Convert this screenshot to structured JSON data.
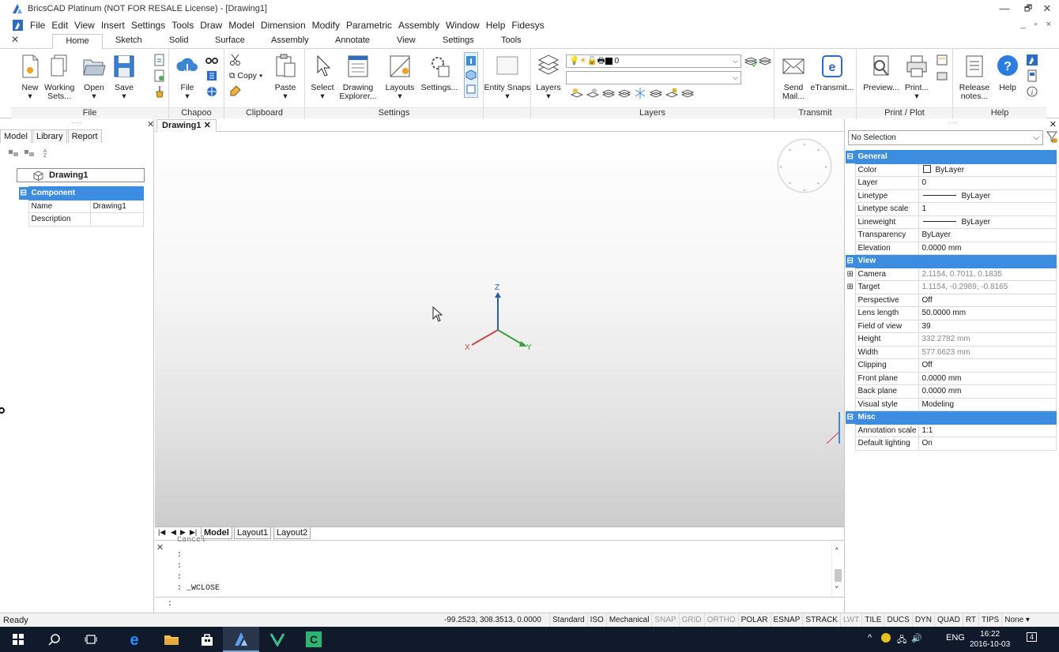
{
  "titlebar": {
    "title": "BricsCAD Platinum (NOT FOR RESALE License) - [Drawing1]",
    "minimize": "—",
    "restore": "🗗",
    "close": "✕"
  },
  "menubar": {
    "items": [
      "File",
      "Edit",
      "View",
      "Insert",
      "Settings",
      "Tools",
      "Draw",
      "Model",
      "Dimension",
      "Modify",
      "Parametric",
      "Assembly",
      "Window",
      "Help",
      "Fidesys"
    ],
    "mdi_controls": "_ ▫ ×"
  },
  "ribbon_tabs": [
    "Home",
    "Sketch",
    "Solid",
    "Surface",
    "Assembly",
    "Annotate",
    "View",
    "Settings",
    "Tools"
  ],
  "ribbon": {
    "groups": {
      "file": "File",
      "chapoo": "Chapoo",
      "clipboard": "Clipboard",
      "settings": "Settings",
      "entity_snaps_blank": "",
      "layers": "Layers",
      "transmit": "Transmit",
      "print": "Print / Plot",
      "help": "Help"
    },
    "buttons": {
      "new": "New",
      "working_sets_1": "Working",
      "working_sets_2": "Sets...",
      "open": "Open",
      "save": "Save",
      "file": "File",
      "copy": "Copy",
      "paste": "Paste",
      "select": "Select",
      "drawing_explorer_1": "Drawing",
      "drawing_explorer_2": "Explorer...",
      "layouts": "Layouts",
      "settings": "Settings...",
      "entity_snaps": "Entity Snaps",
      "layers": "Layers",
      "send_mail_1": "Send",
      "send_mail_2": "Mail...",
      "etransmit": "eTransmit...",
      "preview": "Preview...",
      "print": "Print...",
      "release_notes_1": "Release",
      "release_notes_2": "notes...",
      "help": "Help"
    },
    "layer_combo_value": "0",
    "layer_combo2_value": ""
  },
  "left_panel": {
    "tabs": [
      "Model",
      "Library",
      "Report"
    ],
    "active_tab": "Model",
    "root_node": "Drawing1",
    "section": "Component",
    "rows": [
      {
        "label": "Name",
        "value": "Drawing1"
      },
      {
        "label": "Description",
        "value": ""
      }
    ]
  },
  "drawing_tab": "Drawing1",
  "layout_tabs": [
    "Model",
    "Layout1",
    "Layout2"
  ],
  "axes": {
    "x": "X",
    "y": "Y",
    "z": "Z"
  },
  "command": {
    "history": [
      "Cancel",
      ":",
      ":",
      ":",
      ": _WCLOSE"
    ],
    "prompt": ":"
  },
  "properties": {
    "selection": "No Selection",
    "sections": [
      {
        "name": "General",
        "rows": [
          {
            "label": "Color",
            "value": "ByLayer",
            "swatch": true
          },
          {
            "label": "Layer",
            "value": "0"
          },
          {
            "label": "Linetype",
            "value": "ByLayer",
            "line": true
          },
          {
            "label": "Linetype scale",
            "value": "1"
          },
          {
            "label": "Lineweight",
            "value": "ByLayer",
            "line": true
          },
          {
            "label": "Transparency",
            "value": "ByLayer"
          },
          {
            "label": "Elevation",
            "value": "0.0000 mm"
          }
        ]
      },
      {
        "name": "View",
        "rows": [
          {
            "label": "Camera",
            "value": "2.1154, 0.7011, 0.1835",
            "expander": true,
            "gray": true
          },
          {
            "label": "Target",
            "value": "1.1154, -0.2989, -0.8165",
            "expander": true,
            "gray": true
          },
          {
            "label": "Perspective",
            "value": "Off"
          },
          {
            "label": "Lens length",
            "value": "50.0000 mm"
          },
          {
            "label": "Field of view",
            "value": "39"
          },
          {
            "label": "Height",
            "value": "332.2782 mm",
            "gray": true
          },
          {
            "label": "Width",
            "value": "577.6623 mm",
            "gray": true
          },
          {
            "label": "Clipping",
            "value": "Off"
          },
          {
            "label": "Front plane",
            "value": "0.0000 mm"
          },
          {
            "label": "Back plane",
            "value": "0.0000 mm"
          },
          {
            "label": "Visual style",
            "value": "Modeling"
          }
        ]
      },
      {
        "name": "Misc",
        "rows": [
          {
            "label": "Annotation scale",
            "value": "1:1"
          },
          {
            "label": "Default lighting",
            "value": "On"
          }
        ]
      }
    ]
  },
  "statusbar": {
    "ready": "Ready",
    "coords": "-99.2523, 308.3513, 0.0000",
    "items": [
      {
        "label": "Standard",
        "on": true
      },
      {
        "label": "ISO",
        "on": true
      },
      {
        "label": "Mechanical",
        "on": true
      },
      {
        "label": "SNAP",
        "on": false
      },
      {
        "label": "GRID",
        "on": false
      },
      {
        "label": "ORTHO",
        "on": false
      },
      {
        "label": "POLAR",
        "on": true
      },
      {
        "label": "ESNAP",
        "on": true
      },
      {
        "label": "STRACK",
        "on": true
      },
      {
        "label": "LWT",
        "on": false
      },
      {
        "label": "TILE",
        "on": true
      },
      {
        "label": "DUCS",
        "on": true
      },
      {
        "label": "DYN",
        "on": true
      },
      {
        "label": "QUAD",
        "on": true
      },
      {
        "label": "RT",
        "on": true
      },
      {
        "label": "TIPS",
        "on": true
      },
      {
        "label": "None ▾",
        "on": true
      }
    ]
  },
  "taskbar": {
    "lang": "ENG",
    "time": "16:22",
    "date": "2016-10-03",
    "notifications": "4"
  },
  "colors": {
    "accent": "#3c8de0",
    "taskbar": "#101a2a"
  }
}
